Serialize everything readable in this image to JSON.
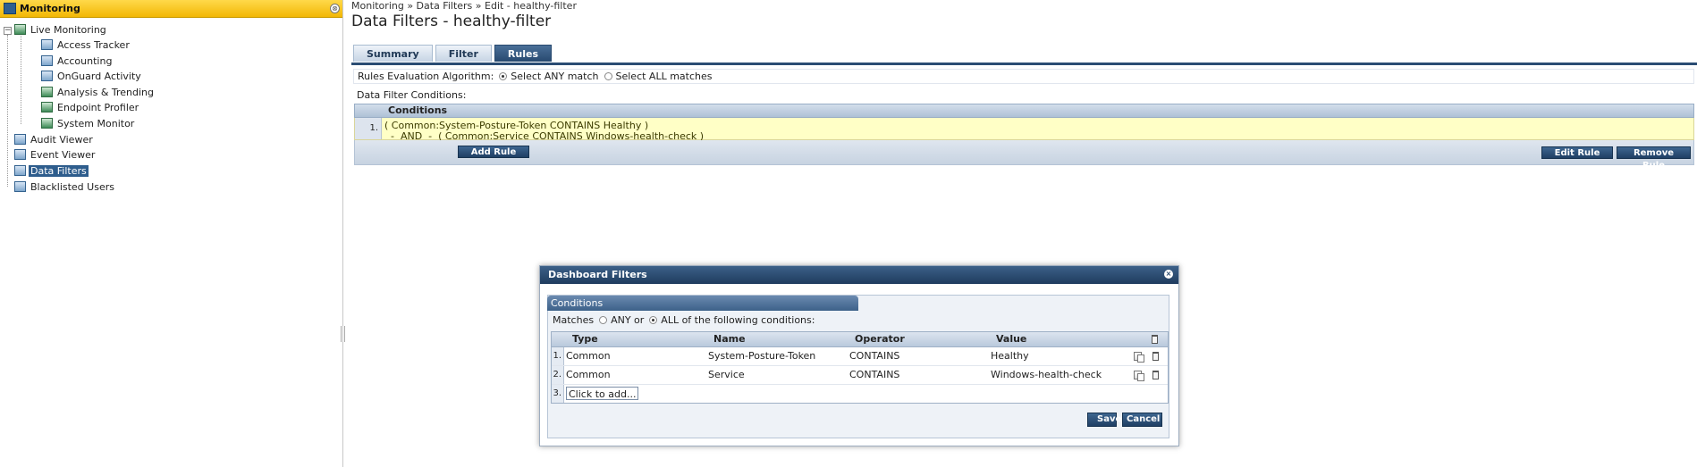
{
  "sidebar": {
    "title": "Monitoring",
    "items": [
      {
        "label": "Live Monitoring"
      },
      {
        "label": "Access Tracker"
      },
      {
        "label": "Accounting"
      },
      {
        "label": "OnGuard Activity"
      },
      {
        "label": "Analysis & Trending"
      },
      {
        "label": "Endpoint Profiler"
      },
      {
        "label": "System Monitor"
      },
      {
        "label": "Audit Viewer"
      },
      {
        "label": "Event Viewer"
      },
      {
        "label": "Data Filters"
      },
      {
        "label": "Blacklisted Users"
      }
    ],
    "collapse_glyph": "−",
    "header_btn_glyph": "⊗"
  },
  "main": {
    "breadcrumb": "Monitoring » Data Filters » Edit - healthy-filter",
    "title": "Data Filters - healthy-filter",
    "tabs": [
      {
        "label": "Summary"
      },
      {
        "label": "Filter"
      },
      {
        "label": "Rules"
      }
    ],
    "rules": {
      "algorithm_label": "Rules Evaluation Algorithm:",
      "option_any": "Select ANY match",
      "option_all": "Select ALL matches",
      "conditions_label": "Data Filter Conditions:",
      "column_header": "Conditions",
      "row_number": "1.",
      "row_line1": "( Common:System-Posture-Token CONTAINS Healthy )",
      "row_line2": "  -  AND  -  ( Common:Service CONTAINS Windows-health-check )",
      "add_rule": "Add Rule",
      "edit_rule": "Edit Rule",
      "remove_rule": "Remove Rule"
    }
  },
  "dialog": {
    "title": "Dashboard Filters",
    "close_glyph": "×",
    "tab": "Conditions",
    "match_prefix": "Matches",
    "match_any": "ANY or",
    "match_all": "ALL of the following conditions:",
    "columns": {
      "type": "Type",
      "name": "Name",
      "operator": "Operator",
      "value": "Value"
    },
    "rows": [
      {
        "num": "1.",
        "type": "Common",
        "name": "System-Posture-Token",
        "operator": "CONTAINS",
        "value": "Healthy"
      },
      {
        "num": "2.",
        "type": "Common",
        "name": "Service",
        "operator": "CONTAINS",
        "value": "Windows-health-check"
      }
    ],
    "add_row_num": "3.",
    "add_row_label": "Click to add...",
    "save": "Save",
    "cancel": "Cancel"
  }
}
